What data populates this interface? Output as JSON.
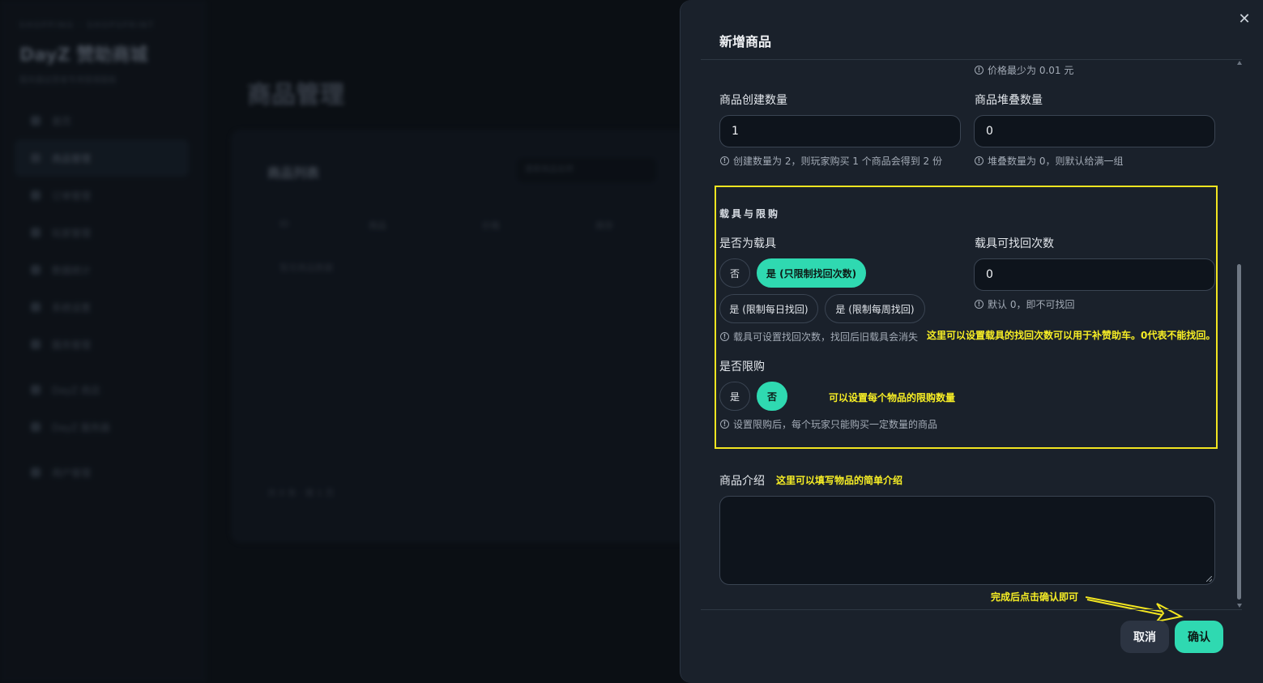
{
  "background": {
    "subtitle": "SHOPPING · SHOPSPRINT",
    "brand": "DayZ 赞助商城",
    "description": "服务器运营者专用管理面板",
    "nav": [
      "首页",
      "商品管理",
      "订单管理",
      "玩家管理",
      "数据统计",
      "系统设置",
      "服务管理",
      "DayZ 商店",
      "DayZ 服务器",
      "用户管理"
    ],
    "page_title": "商品管理",
    "card_title": "商品列表",
    "search_placeholder": "搜索商品名称",
    "table_headers": [
      "ID",
      "商品",
      "价格",
      "库存"
    ],
    "empty_text": "暂无商品数据",
    "total_text": "共 0 条 · 第 1 页"
  },
  "drawer": {
    "title": "新增商品",
    "close_icon": "close-icon",
    "price_hint": "价格最少为 0.01 元",
    "create_qty": {
      "label": "商品创建数量",
      "value": "1",
      "hint": "创建数量为 2，则玩家购买 1 个商品会得到 2 份"
    },
    "stack_qty": {
      "label": "商品堆叠数量",
      "value": "0",
      "hint": "堆叠数量为 0，则默认给满一组"
    },
    "vehicle_section": {
      "title": "载具与限购",
      "is_vehicle_label": "是否为载具",
      "vehicle_options": [
        "否",
        "是 (只限制找回次数)",
        "是 (限制每日找回)",
        "是 (限制每周找回)"
      ],
      "vehicle_selected": "是 (只限制找回次数)",
      "vehicle_hint": "载具可设置找回次数，找回后旧载具会消失",
      "recover_label": "载具可找回次数",
      "recover_value": "0",
      "recover_hint": "默认 0，即不可找回",
      "limit_label": "是否限购",
      "limit_options": [
        "是",
        "否"
      ],
      "limit_selected": "否",
      "limit_hint": "设置限购后，每个玩家只能购买一定数量的商品"
    },
    "intro": {
      "label": "商品介绍",
      "value": ""
    },
    "cancel_label": "取消",
    "confirm_label": "确认"
  },
  "annotations": {
    "recover_note": "这里可以设置载具的找回次数可以用于补赞助车。0代表不能找回。",
    "limit_note": "可以设置每个物品的限购数量",
    "intro_note": "这里可以填写物品的简单介绍",
    "confirm_note": "完成后点击确认即可",
    "highlight_color": "#f2e520"
  },
  "colors": {
    "accent": "#2fd9b1",
    "drawer_bg": "#1a212b",
    "input_bg": "#0e141c"
  }
}
